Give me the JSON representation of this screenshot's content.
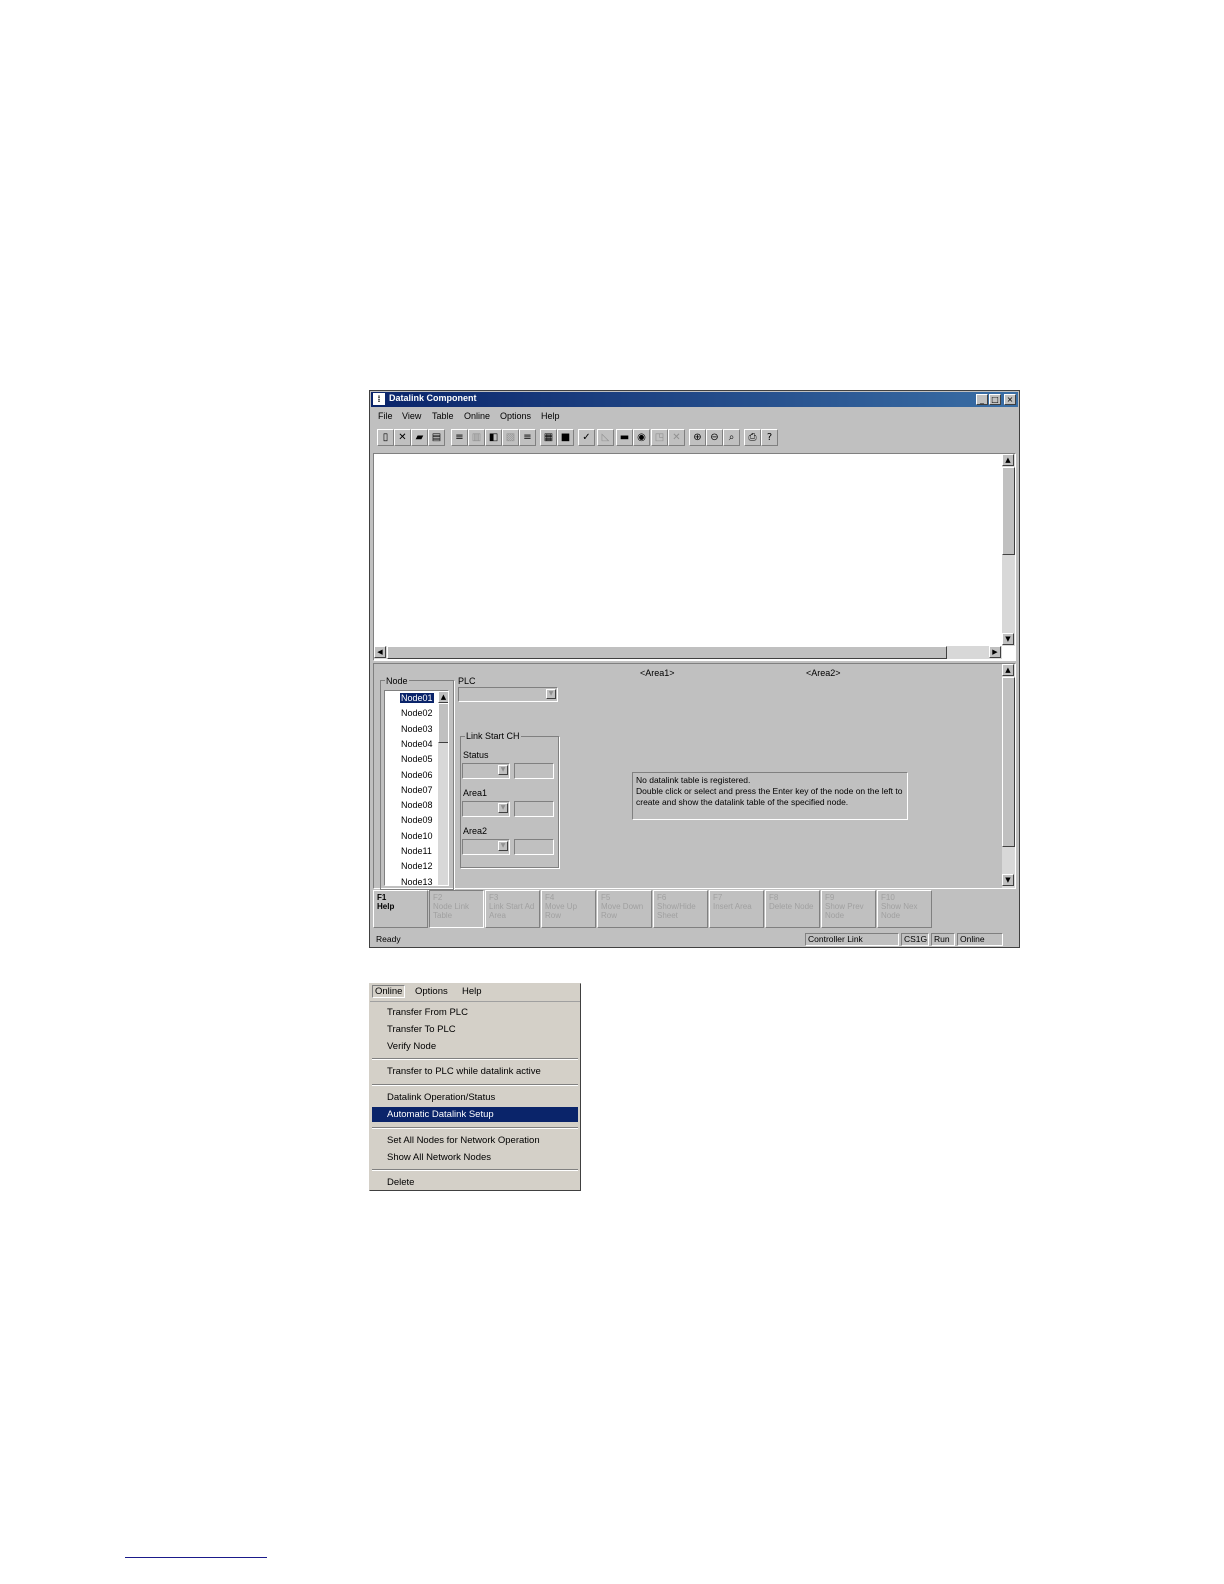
{
  "window": {
    "title": "Datalink Component",
    "icon": "app-icon",
    "controls": {
      "minimize": "_",
      "maximize": "□",
      "close": "×"
    }
  },
  "menubar": [
    "File",
    "View",
    "Table",
    "Online",
    "Options",
    "Help"
  ],
  "toolbar": {
    "buttons": [
      {
        "icon": "new-icon",
        "glyph": "▯"
      },
      {
        "icon": "delete-icon",
        "glyph": "✕"
      },
      {
        "icon": "open-icon",
        "glyph": "▰"
      },
      {
        "icon": "save-icon",
        "glyph": "▤"
      },
      {
        "icon": "tool-icon",
        "glyph": "≡"
      },
      {
        "icon": "tool-icon",
        "glyph": "▥"
      },
      {
        "icon": "tool-icon",
        "glyph": "◧"
      },
      {
        "icon": "tool-icon",
        "glyph": "▧"
      },
      {
        "icon": "tool-icon",
        "glyph": "≡"
      },
      {
        "icon": "tool-icon",
        "glyph": "▦"
      },
      {
        "icon": "tool-icon",
        "glyph": "■"
      },
      {
        "icon": "check-icon",
        "glyph": "✓"
      },
      {
        "icon": "tool-icon",
        "glyph": "◺"
      },
      {
        "icon": "tool-icon",
        "glyph": "▬"
      },
      {
        "icon": "online-icon",
        "glyph": "◉"
      },
      {
        "icon": "tool-icon",
        "glyph": "◳"
      },
      {
        "icon": "cancel-icon",
        "glyph": "✕"
      },
      {
        "icon": "zoom-in-icon",
        "glyph": "⊕"
      },
      {
        "icon": "zoom-out-icon",
        "glyph": "⊖"
      },
      {
        "icon": "zoom-icon",
        "glyph": "⌕"
      },
      {
        "icon": "print-icon",
        "glyph": "⎙"
      },
      {
        "icon": "help-icon",
        "glyph": "?"
      }
    ]
  },
  "lower": {
    "node_label": "Node",
    "nodes": [
      "Node01",
      "Node02",
      "Node03",
      "Node04",
      "Node05",
      "Node06",
      "Node07",
      "Node08",
      "Node09",
      "Node10",
      "Node11",
      "Node12",
      "Node13"
    ],
    "selected_node": "Node01",
    "plc_label": "PLC",
    "link_start_label": "Link Start CH",
    "status_label": "Status",
    "area1_label": "Area1",
    "area2_label": "Area2",
    "area1_header": "<Area1>",
    "area2_header": "<Area2>",
    "message": "No datalink table is registered.\nDouble click or select and press the Enter key of the node on the left to create and show the datalink table of the specified node."
  },
  "fkeys": [
    {
      "key": "F1",
      "label": "Help",
      "enabled": true
    },
    {
      "key": "F2",
      "label": "Node Link Table",
      "enabled": false
    },
    {
      "key": "F3",
      "label": "Link Start Ad Area",
      "enabled": false
    },
    {
      "key": "F4",
      "label": "Move Up Row",
      "enabled": false
    },
    {
      "key": "F5",
      "label": "Move Down Row",
      "enabled": false
    },
    {
      "key": "F6",
      "label": "Show/Hide Sheet",
      "enabled": false
    },
    {
      "key": "F7",
      "label": "Insert Area",
      "enabled": false
    },
    {
      "key": "F8",
      "label": "Delete Node",
      "enabled": false
    },
    {
      "key": "F9",
      "label": "Show Prev Node",
      "enabled": false
    },
    {
      "key": "F10",
      "label": "Show Nex Node",
      "enabled": false
    }
  ],
  "statusbar": {
    "text": "Ready",
    "network": "Controller Link",
    "plc": "CS1G",
    "mode": "Run",
    "connection": "Online"
  },
  "popup": {
    "menubar": [
      "Online",
      "Options",
      "Help"
    ],
    "items": [
      {
        "label": "Transfer From PLC",
        "highlight": false
      },
      {
        "label": "Transfer To PLC",
        "highlight": false
      },
      {
        "label": "Verify Node",
        "highlight": false
      },
      {
        "sep": true
      },
      {
        "label": "Transfer to PLC while datalink active",
        "highlight": false
      },
      {
        "sep": true
      },
      {
        "label": "Datalink Operation/Status",
        "highlight": false
      },
      {
        "label": "Automatic Datalink Setup",
        "highlight": true
      },
      {
        "sep": true
      },
      {
        "label": "Set All Nodes for Network Operation",
        "highlight": false
      },
      {
        "label": "Show All Network Nodes",
        "highlight": false
      },
      {
        "sep": true
      },
      {
        "label": "Delete",
        "highlight": false
      }
    ]
  }
}
